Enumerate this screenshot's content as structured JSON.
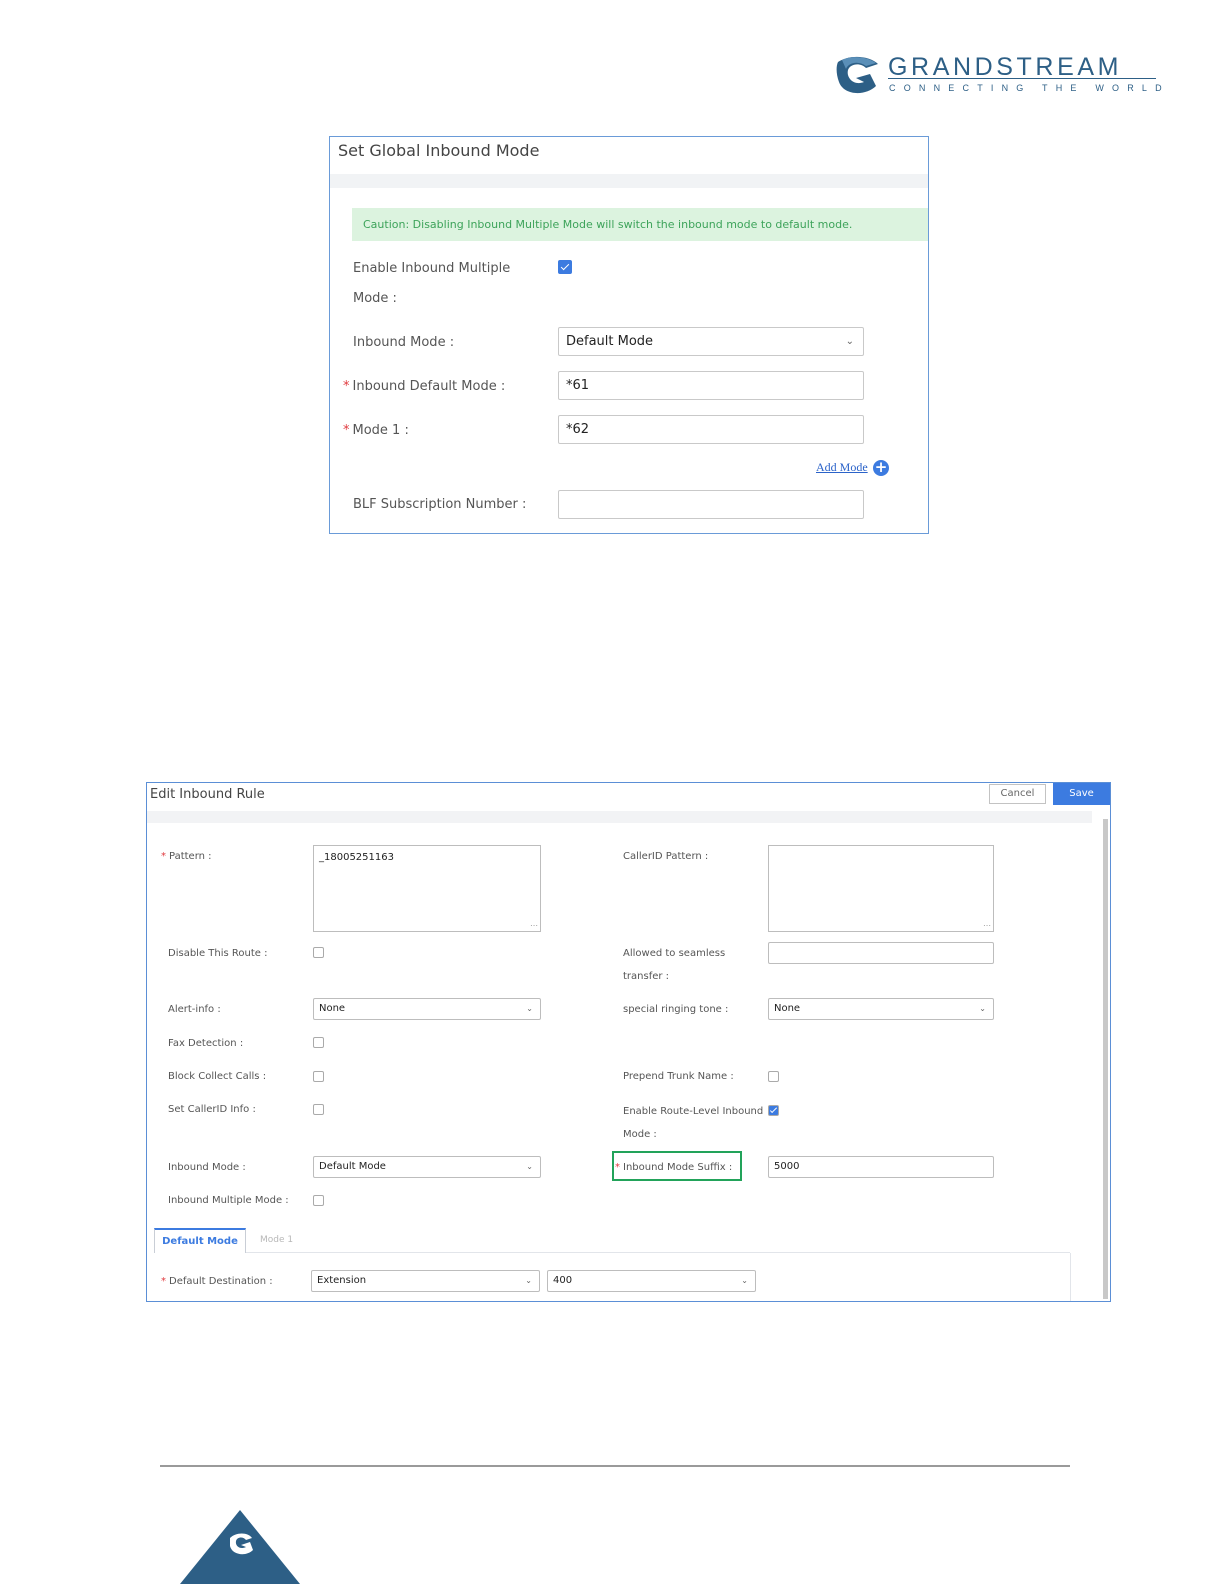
{
  "logo": {
    "word": "GRANDSTREAM",
    "tagline": "CONNECTING THE WORLD"
  },
  "global_mode": {
    "title": "Set Global Inbound Mode",
    "caution": "Caution: Disabling Inbound Multiple Mode will switch the inbound mode to default mode.",
    "enable_label_1": "Enable Inbound Multiple",
    "enable_label_2": "Mode :",
    "enable_checked": true,
    "inbound_mode_label": "Inbound Mode :",
    "inbound_mode_value": "Default Mode",
    "default_mode_label": "Inbound Default Mode :",
    "default_mode_value": "*61",
    "mode1_label": "Mode 1 :",
    "mode1_value": "*62",
    "add_mode": "Add Mode",
    "blf_label": "BLF Subscription Number :",
    "blf_value": ""
  },
  "edit_rule": {
    "title": "Edit Inbound Rule",
    "cancel": "Cancel",
    "save": "Save",
    "pattern_label": "Pattern :",
    "pattern_value": "_18005251163",
    "callerid_pattern_label": "CallerID Pattern :",
    "callerid_pattern_value": "",
    "disable_route_label": "Disable This Route :",
    "seamless_label_1": "Allowed to seamless",
    "seamless_label_2": "transfer :",
    "seamless_value": "",
    "alert_info_label": "Alert-info :",
    "alert_info_value": "None",
    "ringing_tone_label": "special ringing tone :",
    "ringing_tone_value": "None",
    "fax_label": "Fax Detection :",
    "block_collect_label": "Block Collect Calls :",
    "prepend_label": "Prepend Trunk Name :",
    "set_callerid_label": "Set CallerID Info :",
    "route_level_label_1": "Enable Route-Level Inbound",
    "route_level_label_2": "Mode :",
    "route_level_checked": true,
    "inbound_mode_label": "Inbound Mode :",
    "inbound_mode_value": "Default Mode",
    "suffix_label": "Inbound Mode Suffix :",
    "suffix_value": "5000",
    "multiple_mode_label": "Inbound Multiple Mode :",
    "tabs": [
      "Default Mode",
      "Mode 1"
    ],
    "default_dest_label": "Default Destination :",
    "default_dest_type": "Extension",
    "default_dest_value": "400"
  },
  "colors": {
    "accent": "#3c7be0",
    "brand": "#2d5f86",
    "highlight": "#22a35a",
    "caution_bg": "#dcf3df"
  }
}
